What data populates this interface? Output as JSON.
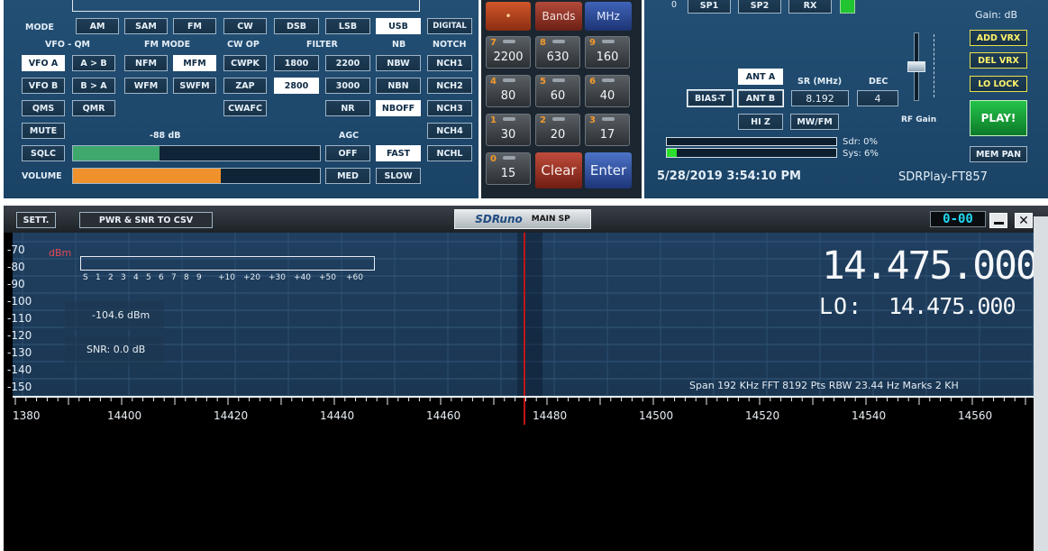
{
  "receiver": {
    "labels": {
      "mode": "MODE",
      "vfo_qm": "VFO - QM",
      "fm_mode": "FM MODE",
      "cw_op": "CW OP",
      "filter": "FILTER",
      "nb": "NB",
      "notch": "NOTCH",
      "agc": "AGC",
      "volume": "VOLUME",
      "signal_level": "-88 dB"
    },
    "modes": [
      "AM",
      "SAM",
      "FM",
      "CW",
      "DSB",
      "LSB",
      "USB",
      "DIGITAL"
    ],
    "vfo": [
      "VFO A",
      "A > B",
      "VFO B",
      "B > A",
      "QMS",
      "QMR",
      "MUTE",
      "SQLC"
    ],
    "fm_modes": [
      "NFM",
      "MFM",
      "WFM",
      "SWFM"
    ],
    "cw_ops": [
      "CWPK",
      "ZAP",
      "CWAFC"
    ],
    "filters": [
      "1800",
      "2200",
      "2800",
      "3000",
      "NR",
      "MED",
      "SLOW"
    ],
    "nb": [
      "NBW",
      "NBN",
      "NBOFF",
      "OFF",
      "FAST"
    ],
    "notch": [
      "NCH1",
      "NCH2",
      "NCH3",
      "NCH4",
      "NCHL"
    ],
    "levels": {
      "squelch": 0.35,
      "volume": 0.6
    },
    "colors": {
      "squelch": "#3fa86c",
      "volume": "#f0922b"
    }
  },
  "keypad": {
    "top": [
      "•",
      "Bands",
      "MHz"
    ],
    "keys": [
      {
        "d": "7",
        "v": "2200"
      },
      {
        "d": "8",
        "v": "630"
      },
      {
        "d": "9",
        "v": "160"
      },
      {
        "d": "4",
        "v": "80"
      },
      {
        "d": "5",
        "v": "60"
      },
      {
        "d": "6",
        "v": "40"
      },
      {
        "d": "1",
        "v": "30"
      },
      {
        "d": "2",
        "v": "20"
      },
      {
        "d": "3",
        "v": "17"
      },
      {
        "d": "0",
        "v": "15"
      }
    ],
    "clear": "Clear",
    "enter": "Enter"
  },
  "control": {
    "top_num": "0",
    "sp1": "SP1",
    "sp2": "SP2",
    "rx": "RX",
    "gain_label": "Gain: dB",
    "add_vrx": "ADD VRX",
    "del_vrx": "DEL VRX",
    "lo_lock": "LO LOCK",
    "play": "PLAY!",
    "mem_pan": "MEM PAN",
    "ant_a": "ANT A",
    "ant_b": "ANT B",
    "bias_t": "BIAS-T",
    "hi_z": "HI Z",
    "mw_fm": "MW/FM",
    "sr_label": "SR (MHz)",
    "sr_value": "8.192",
    "dec_label": "DEC",
    "dec_value": "4",
    "rf_gain": "RF Gain",
    "sdr_load": "Sdr: 0%",
    "sys_load": "Sys: 6%",
    "datetime": "5/28/2019 3:54:10 PM",
    "profile": "SDRPlay-FT857",
    "rf_gain_level": 0.55
  },
  "spectrum": {
    "sett": "SETT.",
    "csv": "PWR & SNR TO CSV",
    "brand": "SDRuno",
    "title": "MAIN SP",
    "timer": "0-00",
    "dbm_unit": "dBm",
    "y_labels": [
      "-70",
      "-80",
      "-90",
      "-100",
      "-110",
      "-120",
      "-130",
      "-140",
      "-150"
    ],
    "smeter_ticks": [
      "S",
      "1",
      "2",
      "3",
      "4",
      "5",
      "6",
      "7",
      "8",
      "9",
      "+10",
      "+20",
      "+30",
      "+40",
      "+50",
      "+60"
    ],
    "power": "-104.6 dBm",
    "snr": "SNR: 0.0 dB",
    "freq": "14.475.000",
    "lo": "LO:",
    "lo_freq": "14.475.000",
    "info": "Span 192 KHz  FFT 8192 Pts  RBW 23.44 Hz  Marks 2 KH",
    "x_labels": [
      "1380",
      "14400",
      "14420",
      "14440",
      "14460",
      "14480",
      "14500",
      "14520",
      "14540",
      "14560"
    ]
  }
}
